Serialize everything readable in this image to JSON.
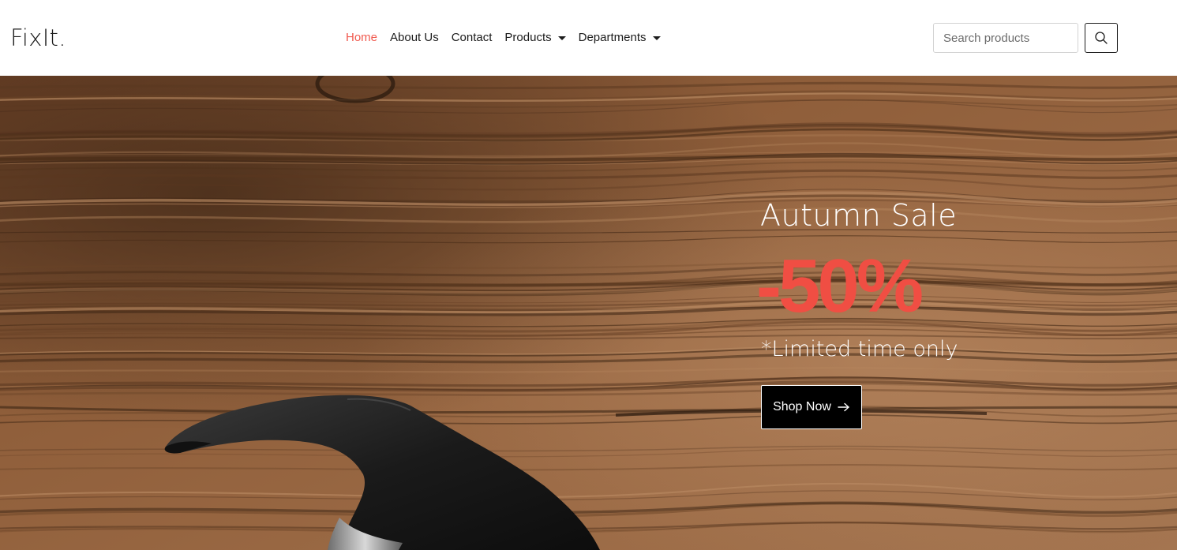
{
  "brand": "FixIt.",
  "nav": {
    "home": "Home",
    "about": "About Us",
    "contact": "Contact",
    "products": "Products",
    "departments": "Departments"
  },
  "search": {
    "placeholder": "Search products",
    "button_icon": "search-icon"
  },
  "hero": {
    "title": "Autumn Sale",
    "discount": "-50%",
    "note": "*Limited time only",
    "button_label": "Shop Now",
    "button_icon": "arrow-right-icon",
    "image": "hammer-on-wood-icon"
  },
  "colors": {
    "accent": "#f05a4f",
    "discount": "#f04e43",
    "text": "#1c1c1c",
    "button_bg": "#000000"
  }
}
